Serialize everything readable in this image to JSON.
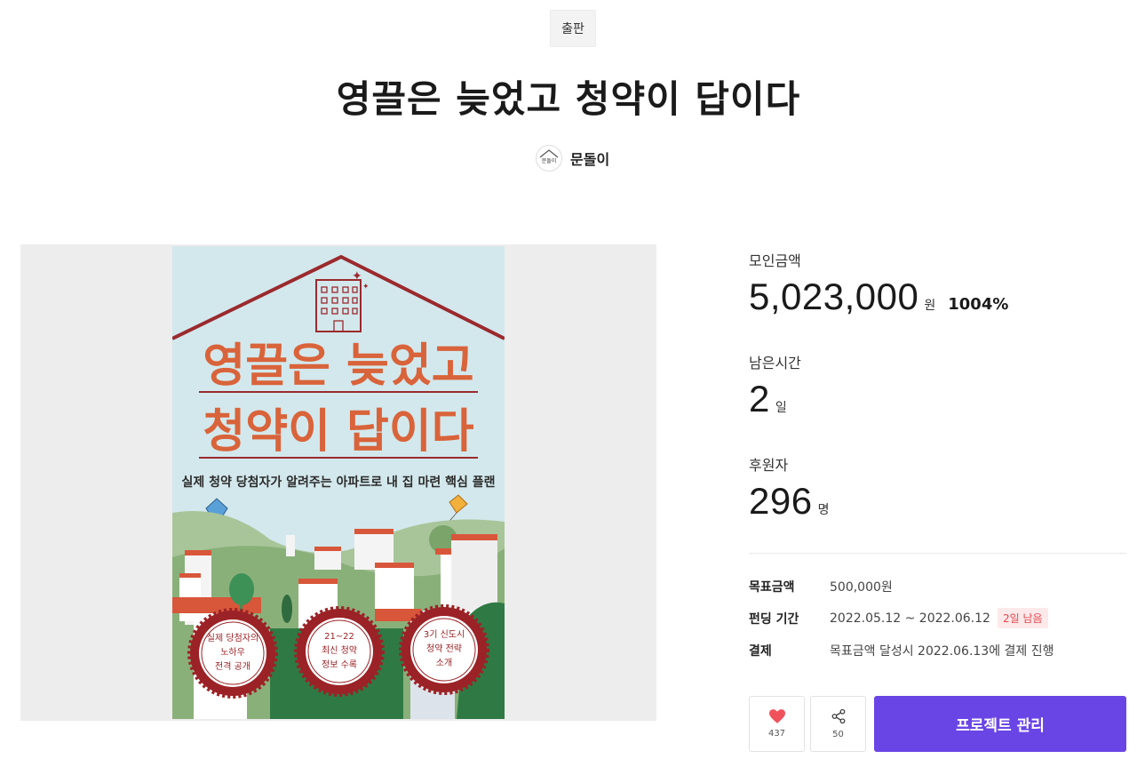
{
  "category": "출판",
  "title": "영끌은 늦었고 청약이 답이다",
  "creator": {
    "name": "문돌이",
    "avatar_text": "문돌이"
  },
  "poster": {
    "headline_line1": "영끌은 늦었고",
    "headline_line2": "청약이 답이다",
    "subtitle": "실제 청약 당첨자가 알려주는 아파트로 내 집 마련 핵심 플랜",
    "seals": [
      {
        "line1": "실제 당첨자의",
        "line2": "노하우",
        "line3": "전격 공개"
      },
      {
        "line1": "21~22",
        "line2": "최신 청약",
        "line3": "정보 수록"
      },
      {
        "line1": "3기 신도시",
        "line2": "청약 전략",
        "line3": "소개"
      }
    ],
    "colors": {
      "sky": "#d3e8ec",
      "headline": "#d9633a",
      "roof": "#9a2a2e",
      "seal": "#9b2226",
      "hill": "#8ab07a"
    }
  },
  "stats": {
    "amount": {
      "label": "모인금액",
      "value": "5,023,000",
      "unit": "원",
      "percent": "1004%"
    },
    "time": {
      "label": "남은시간",
      "value": "2",
      "unit": "일"
    },
    "backers": {
      "label": "후원자",
      "value": "296",
      "unit": "명"
    }
  },
  "info": {
    "goal": {
      "label": "목표금액",
      "value": "500,000원"
    },
    "period": {
      "label": "펀딩 기간",
      "value": "2022.05.12 ~ 2022.06.12",
      "badge": "2일 남음"
    },
    "payment": {
      "label": "결제",
      "value": "목표금액 달성시 2022.06.13에 결제 진행"
    }
  },
  "actions": {
    "like_count": "437",
    "share_count": "50",
    "manage_label": "프로젝트 관리"
  },
  "colors": {
    "accent": "#6a45e6",
    "heart": "#f0525c",
    "badge_text": "#e8474f"
  }
}
